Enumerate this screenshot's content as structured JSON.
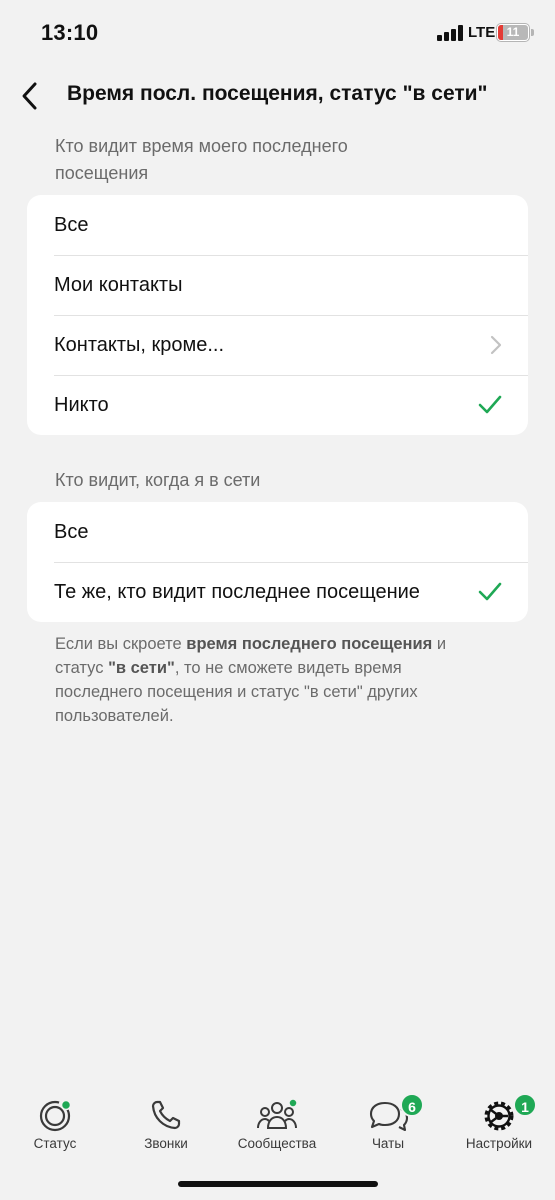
{
  "status_bar": {
    "time": "13:10",
    "network": "LTE",
    "battery": "11"
  },
  "header": {
    "back_icon": "chevron-left-icon",
    "title": "Время посл. посещения, статус \"в сети\""
  },
  "last_seen": {
    "header": "Кто видит время моего последнего посещения",
    "options": [
      {
        "label": "Все",
        "selected": false
      },
      {
        "label": "Мои контакты",
        "selected": false
      },
      {
        "label": "Контакты, кроме...",
        "selected": false,
        "has_disclosure": true
      },
      {
        "label": "Никто",
        "selected": true
      }
    ]
  },
  "online": {
    "header": "Кто видит, когда я в сети",
    "options": [
      {
        "label": "Все",
        "selected": false
      },
      {
        "label": "Те же, кто видит последнее посещение",
        "selected": true
      }
    ]
  },
  "footnote": {
    "part1": "Если вы скроете ",
    "bold1": "время последнего посещения",
    "part2": " и статус ",
    "bold2": "\"в сети\"",
    "part3": ", то не сможете видеть время последнего посещения и статус \"в сети\" других пользователей."
  },
  "tabs": [
    {
      "label": "Статус",
      "icon": "status-icon",
      "active": false,
      "dot": true
    },
    {
      "label": "Звонки",
      "icon": "phone-icon",
      "active": false
    },
    {
      "label": "Сообщества",
      "icon": "communities-icon",
      "active": false,
      "dot": true
    },
    {
      "label": "Чаты",
      "icon": "chats-icon",
      "active": false,
      "badge": "6"
    },
    {
      "label": "Настройки",
      "icon": "settings-icon",
      "active": true,
      "badge": "1"
    }
  ],
  "colors": {
    "accent": "#1fa855",
    "background": "#f2f2f2",
    "card": "#ffffff",
    "secondary_text": "#6b6b6b"
  }
}
